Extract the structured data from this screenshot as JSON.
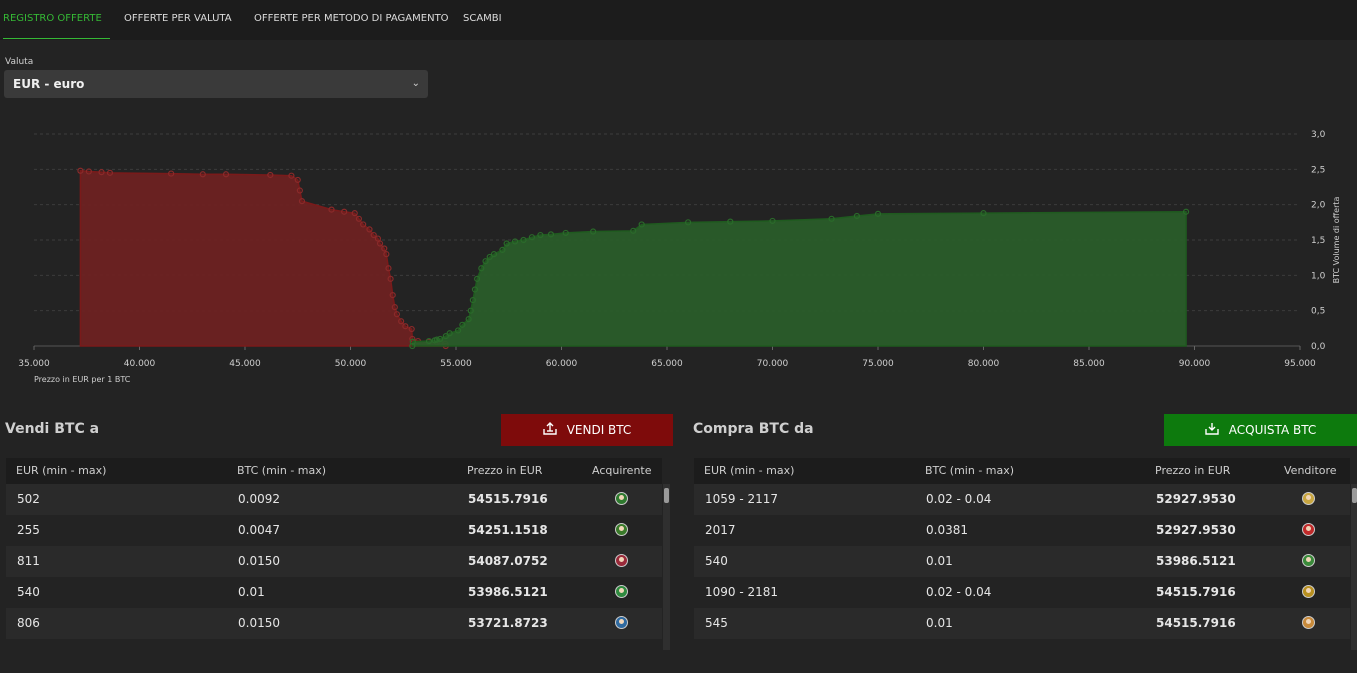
{
  "tabs": [
    {
      "label": "REGISTRO OFFERTE",
      "active": true
    },
    {
      "label": "OFFERTE PER VALUTA"
    },
    {
      "label": "OFFERTE PER METODO DI PAGAMENTO"
    },
    {
      "label": "SCAMBI"
    }
  ],
  "currency": {
    "label": "Valuta",
    "selected": "EUR  -  euro"
  },
  "chart_data": {
    "type": "area",
    "x_label": "Prezzo in EUR per 1 BTC",
    "y_label": "BTC Volume di offerta",
    "x_ticks": [
      "35.000",
      "40.000",
      "45.000",
      "50.000",
      "55.000",
      "60.000",
      "65.000",
      "70.000",
      "75.000",
      "80.000",
      "85.000",
      "90.000",
      "95.000"
    ],
    "y_ticks": [
      "0,0",
      "0,5",
      "1,0",
      "1,5",
      "2,0",
      "2,5",
      "3,0"
    ],
    "xlim": [
      35000,
      95000
    ],
    "ylim": [
      0,
      3.0
    ],
    "grid": true,
    "series": [
      {
        "color": "#6e2222",
        "points": [
          [
            37200,
            2.48
          ],
          [
            37600,
            2.47
          ],
          [
            38200,
            2.46
          ],
          [
            38600,
            2.45
          ],
          [
            41500,
            2.44
          ],
          [
            43000,
            2.43
          ],
          [
            44100,
            2.43
          ],
          [
            46200,
            2.42
          ],
          [
            47200,
            2.41
          ],
          [
            47500,
            2.35
          ],
          [
            47600,
            2.2
          ],
          [
            47700,
            2.05
          ],
          [
            49100,
            1.93
          ],
          [
            49700,
            1.9
          ],
          [
            50200,
            1.88
          ],
          [
            50400,
            1.8
          ],
          [
            50600,
            1.72
          ],
          [
            50900,
            1.65
          ],
          [
            51100,
            1.57
          ],
          [
            51300,
            1.52
          ],
          [
            51400,
            1.45
          ],
          [
            51600,
            1.38
          ],
          [
            51700,
            1.3
          ],
          [
            51800,
            1.1
          ],
          [
            51900,
            0.95
          ],
          [
            52000,
            0.72
          ],
          [
            52100,
            0.55
          ],
          [
            52200,
            0.45
          ],
          [
            52400,
            0.35
          ],
          [
            52600,
            0.28
          ],
          [
            52900,
            0.24
          ],
          [
            52930,
            0.1
          ],
          [
            53200,
            0.07
          ],
          [
            53700,
            0.06
          ],
          [
            54100,
            0.05
          ],
          [
            54250,
            0.04
          ],
          [
            54500,
            0.03
          ],
          [
            54515,
            0.0
          ]
        ]
      },
      {
        "color": "#2a5d2a",
        "points": [
          [
            52930,
            0.0
          ],
          [
            52950,
            0.06
          ],
          [
            53720,
            0.07
          ],
          [
            53990,
            0.08
          ],
          [
            54090,
            0.09
          ],
          [
            54250,
            0.1
          ],
          [
            54520,
            0.14
          ],
          [
            54700,
            0.18
          ],
          [
            55100,
            0.22
          ],
          [
            55300,
            0.3
          ],
          [
            55600,
            0.38
          ],
          [
            55700,
            0.5
          ],
          [
            55800,
            0.65
          ],
          [
            55900,
            0.8
          ],
          [
            56000,
            0.95
          ],
          [
            56200,
            1.1
          ],
          [
            56400,
            1.2
          ],
          [
            56600,
            1.26
          ],
          [
            56800,
            1.3
          ],
          [
            57200,
            1.36
          ],
          [
            57400,
            1.45
          ],
          [
            57800,
            1.48
          ],
          [
            58200,
            1.5
          ],
          [
            58600,
            1.54
          ],
          [
            59000,
            1.57
          ],
          [
            59500,
            1.58
          ],
          [
            60200,
            1.6
          ],
          [
            61500,
            1.62
          ],
          [
            63400,
            1.63
          ],
          [
            63800,
            1.72
          ],
          [
            66000,
            1.75
          ],
          [
            68000,
            1.76
          ],
          [
            70000,
            1.77
          ],
          [
            72800,
            1.8
          ],
          [
            74000,
            1.84
          ],
          [
            75000,
            1.87
          ],
          [
            80000,
            1.88
          ],
          [
            89600,
            1.9
          ]
        ]
      }
    ]
  },
  "sell": {
    "title": "Vendi BTC a",
    "button": "VENDI BTC",
    "columns": [
      "EUR (min - max)",
      "BTC (min - max)",
      "Prezzo in EUR",
      "Acquirente"
    ],
    "rows": [
      {
        "eur": "502",
        "btc": "0.0092",
        "price": "54515.7916",
        "avatar": "#2f7a2f"
      },
      {
        "eur": "255",
        "btc": "0.0047",
        "price": "54251.1518",
        "avatar": "#3a7a2a"
      },
      {
        "eur": "811",
        "btc": "0.0150",
        "price": "54087.0752",
        "avatar": "#9a2a3a"
      },
      {
        "eur": "540",
        "btc": "0.01",
        "price": "53986.5121",
        "avatar": "#2f8a3f"
      },
      {
        "eur": "806",
        "btc": "0.0150",
        "price": "53721.8723",
        "avatar": "#2f6aa0"
      }
    ]
  },
  "buy": {
    "title": "Compra BTC da",
    "button": "ACQUISTA BTC",
    "columns": [
      "EUR (min - max)",
      "BTC (min - max)",
      "Prezzo in EUR",
      "Venditore"
    ],
    "rows": [
      {
        "eur": "1059 - 2117",
        "btc": "0.02 - 0.04",
        "price": "52927.9530",
        "avatar": "#c8a640"
      },
      {
        "eur": "2017",
        "btc": "0.0381",
        "price": "52927.9530",
        "avatar": "#c02a2a"
      },
      {
        "eur": "540",
        "btc": "0.01",
        "price": "53986.5121",
        "avatar": "#3a8a3a"
      },
      {
        "eur": "1090 - 2181",
        "btc": "0.02 - 0.04",
        "price": "54515.7916",
        "avatar": "#b89020"
      },
      {
        "eur": "545",
        "btc": "0.01",
        "price": "54515.7916",
        "avatar": "#c88a3a"
      }
    ]
  }
}
